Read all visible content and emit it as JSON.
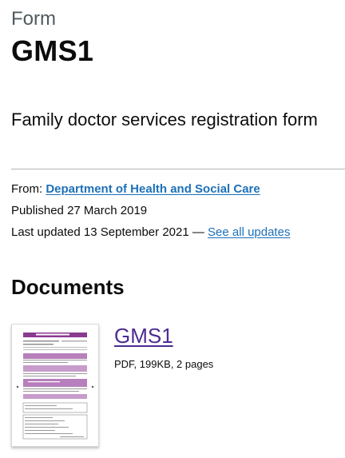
{
  "header": {
    "caption": "Form",
    "title": "GMS1",
    "lede": "Family doctor services registration form"
  },
  "metadata": {
    "from_label": "From:",
    "organisation": "Department of Health and Social Care",
    "published_label": "Published",
    "published_date": "27 March 2019",
    "updated_label": "Last updated",
    "updated_date": "13 September 2021",
    "updated_separator": "—",
    "see_all_updates": "See all updates"
  },
  "documents": {
    "heading": "Documents",
    "items": [
      {
        "title": "GMS1",
        "details": "PDF, 199KB, 2 pages",
        "thumbnail_icon": "pdf-thumbnail-icon"
      }
    ]
  },
  "colors": {
    "text": "#0b0c0c",
    "secondary_text": "#505a5f",
    "link": "#1d70b8",
    "visited_link": "#4c2c92",
    "rule": "#b1b4b6",
    "form_accent": "#8a3a8f"
  }
}
